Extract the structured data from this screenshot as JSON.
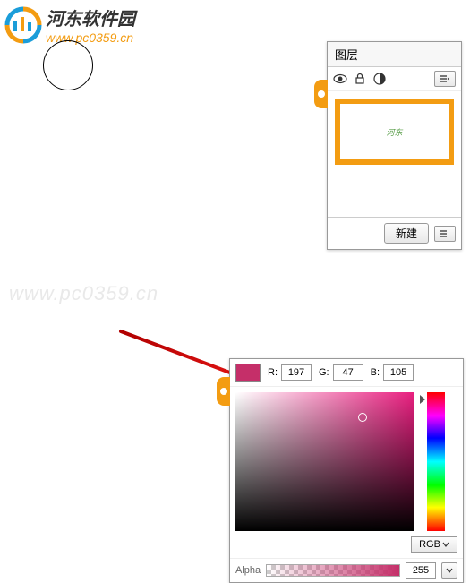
{
  "logo": {
    "title": "河东软件园",
    "url": "www.pc0359.cn"
  },
  "watermark": "www.pc0359.cn",
  "layers_panel": {
    "title": "图层",
    "thumb_label": "河东",
    "new_button": "新建"
  },
  "color_panel": {
    "r_label": "R:",
    "g_label": "G:",
    "b_label": "B:",
    "r_value": "197",
    "g_value": "47",
    "b_value": "105",
    "swatch_color": "#c52f69",
    "alpha_label": "Alpha",
    "alpha_value": "255",
    "mode": "RGB"
  },
  "chart_data": {
    "type": "table",
    "title": "Color Picker RGB Values",
    "series": [
      {
        "name": "R",
        "values": [
          197
        ]
      },
      {
        "name": "G",
        "values": [
          47
        ]
      },
      {
        "name": "B",
        "values": [
          105
        ]
      },
      {
        "name": "Alpha",
        "values": [
          255
        ]
      }
    ]
  }
}
